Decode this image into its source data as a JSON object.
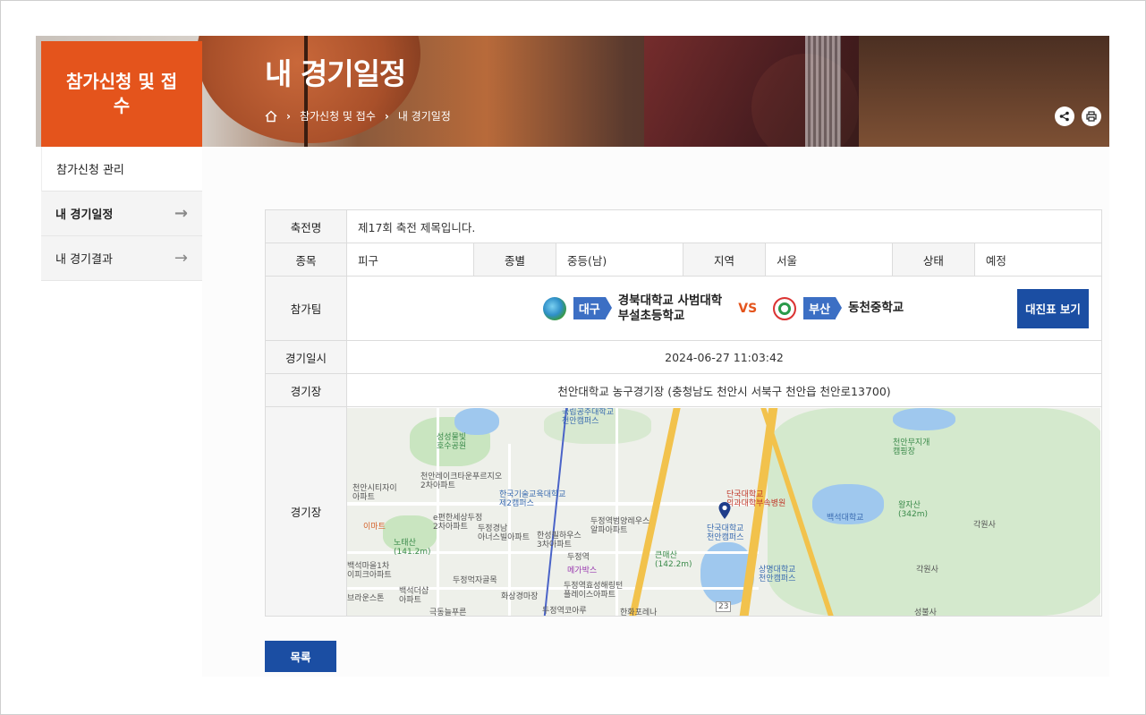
{
  "section": {
    "title": "참가신청 및 접수"
  },
  "page": {
    "title": "내 경기일정"
  },
  "breadcrumb": {
    "items": [
      "참가신청 및 접수",
      "내 경기일정"
    ]
  },
  "side_nav": {
    "items": [
      {
        "label": "참가신청 관리"
      },
      {
        "label": "내 경기일정"
      },
      {
        "label": "내 경기결과"
      }
    ]
  },
  "table": {
    "festival_label": "축전명",
    "festival_value": "제17회 축전 제목입니다.",
    "event_label": "종목",
    "event_value": "피구",
    "category_label": "종별",
    "category_value": "중등(남)",
    "region_label": "지역",
    "region_value": "서울",
    "status_label": "상태",
    "status_value": "예정",
    "teams_label": "참가팀",
    "team_a_region": "대구",
    "team_a_name_line1": "경북대학교 사범대학",
    "team_a_name_line2": "부설초등학교",
    "vs": "VS",
    "team_b_region": "부산",
    "team_b_name": "동천중학교",
    "bracket_button": "대진표 보기",
    "datetime_label": "경기일시",
    "datetime_value": "2024-06-27 11:03:42",
    "venue_label": "경기장",
    "venue_value": "천안대학교 농구경기장 (충청남도 천안시 서북구 천안읍 천안로13700)",
    "map_label": "경기장"
  },
  "map": {
    "labels": {
      "national_univ": "국립공주대학교\n천안캠퍼스",
      "seongsung_lake": "성성물빛\n호수공원",
      "cheonan_lake_apt": "천안레이크타운푸르지오\n2차아파트",
      "city_apt": "천안시티자이\n아파트",
      "korea_tech": "한국기술교육대학교\n제2캠퍼스",
      "emart": "이마트",
      "pyeonhan": "e편한세상두정\n2차아파트",
      "dujeong_innerb": "두정경남\n아너스빌아파트",
      "hansung": "한성필하우스\n3차아파트",
      "dujeong_alpha": "두정역범양레우스\n알파아파트",
      "notae": "노태산\n(141.2m)",
      "baekseok1": "백석마을1차\n이피크아파트",
      "dujeong_st": "두정역",
      "megabox": "메가박스",
      "dujeong_food": "두정먹자골목",
      "hwasang": "화상경마장",
      "baekseok_apt": "백석더샵\n아파트",
      "brown": "브라운스톤",
      "dujeong_hyosung": "두정역효성해링턴\n플레이스아파트",
      "dankook_hosp": "단국대학교\n의과대학부속병원",
      "dankook": "단국대학교\n천안캠퍼스",
      "taejo": "큰매산\n(142.2m)",
      "baekseok_univ": "백석대학교",
      "sangmyung": "상명대학교\n천안캠퍼스",
      "cheonan_camp": "천안무지개\n캠핑장",
      "wangja": "왕자산\n(342m)",
      "gakwon": "각원사",
      "gakwon2": "각원사",
      "route23": "23",
      "hanwha": "한화포레나",
      "dujeong_core": "두정역코아루",
      "keukdong": "극동늘푸른",
      "seongbul": "성불사"
    }
  },
  "actions": {
    "list_button": "목록"
  }
}
